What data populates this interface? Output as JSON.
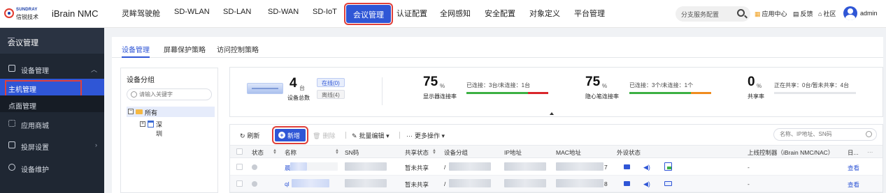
{
  "brand": {
    "logo_en": "SUNDRAY",
    "logo_cn": "信锐技术",
    "app_name": "iBrain NMC"
  },
  "topnav": {
    "items": [
      {
        "label": "灵眸驾驶舱",
        "active": false
      },
      {
        "label": "SD-WLAN",
        "active": false
      },
      {
        "label": "SD-LAN",
        "active": false
      },
      {
        "label": "SD-WAN",
        "active": false
      },
      {
        "label": "SD-IoT",
        "active": false
      },
      {
        "label": "会议管理",
        "active": true
      },
      {
        "label": "认证配置",
        "active": false
      },
      {
        "label": "全网感知",
        "active": false
      },
      {
        "label": "安全配置",
        "active": false
      },
      {
        "label": "对象定义",
        "active": false
      },
      {
        "label": "平台管理",
        "active": false
      }
    ],
    "search_value": "分支服务配置",
    "app_center": "应用中心",
    "feedback": "反馈",
    "community": "社区",
    "username": "admin"
  },
  "sidebar": {
    "title": "会议管理",
    "items": [
      {
        "label": "设备管理",
        "icon": "device-icon",
        "expanded": true,
        "children": [
          {
            "label": "主机管理",
            "active": true
          },
          {
            "label": "点面管理",
            "active": false
          }
        ]
      },
      {
        "label": "应用商城",
        "icon": "app-store-icon"
      },
      {
        "label": "投屏设置",
        "icon": "screen-cast-icon"
      },
      {
        "label": "设备维护",
        "icon": "wrench-icon"
      }
    ]
  },
  "tabs": [
    "设备管理",
    "屏幕保护策略",
    "访问控制策略"
  ],
  "group_panel": {
    "title": "设备分组",
    "search_placeholder": "请输入关键字",
    "tree": {
      "root": "所有",
      "child": "深圳"
    }
  },
  "stats": {
    "devices": {
      "value": "4",
      "unit": "台",
      "caption": "设备总数",
      "online": "在线(0)",
      "offline": "离线(4)"
    },
    "display": {
      "value": "75",
      "unit": "%",
      "caption": "显示器连接率",
      "detail": "已连接：3台/未连接：1台",
      "connected": 3,
      "disconnected": 1
    },
    "privacy": {
      "value": "75",
      "unit": "%",
      "caption": "隐心笔连接率",
      "detail": "已连接：3个/未连接：1个",
      "connected": 3,
      "disconnected": 1
    },
    "sharing": {
      "value": "0",
      "unit": "%",
      "caption": "共享率",
      "detail": "正在共享：0台/暂未共享：4台"
    }
  },
  "toolbar": {
    "refresh": "刷新",
    "add": "新增",
    "delete": "删除",
    "batch_edit": "批量编辑",
    "more": "更多操作",
    "search_placeholder": "名称、IP地址、SN码"
  },
  "table": {
    "columns": [
      "状态",
      "名称",
      "SN码",
      "共享状态",
      "设备分组",
      "IP地址",
      "MAC地址",
      "外设状态",
      "上线控制器（iBrain NMC/NAC）",
      "日..."
    ],
    "rows": [
      {
        "name_prefix": "晨",
        "share": "暂未共享",
        "group_prefix": "/",
        "mac_suffix": "7",
        "controller": "-",
        "action": "查看"
      },
      {
        "name_prefix": "ql",
        "share": "暂未共享",
        "group_prefix": "/",
        "mac_suffix": "8",
        "controller": "-",
        "action": "查看"
      }
    ]
  },
  "colors": {
    "accent": "#2f56d6",
    "highlight_outline": "#e0403a",
    "sidebar_bg": "#1f2733",
    "bar_green": "#3cb043",
    "bar_red": "#d9262b",
    "bar_orange": "#f08b1e"
  }
}
